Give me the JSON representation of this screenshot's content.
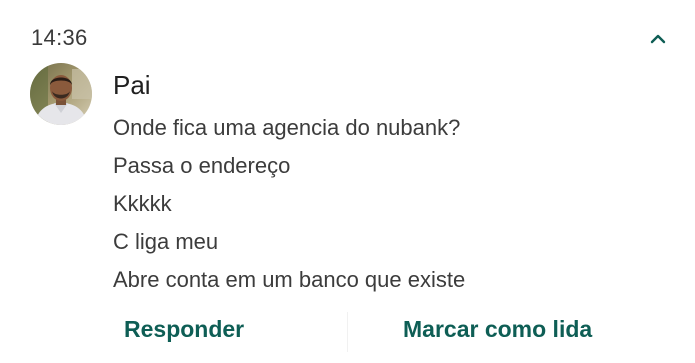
{
  "notification": {
    "time": "14:36",
    "sender": "Pai",
    "messages": [
      "Onde fica uma agencia do nubank?",
      "Passa o endereço",
      "Kkkkk",
      "C liga meu",
      "Abre conta em um banco que existe"
    ],
    "actions": {
      "reply": "Responder",
      "mark_read": "Marcar como lida"
    }
  },
  "icons": {
    "collapse": "chevron-up-icon",
    "avatar": "contact-avatar"
  },
  "colors": {
    "accent": "#0e5e55",
    "text_primary": "#202020",
    "text_secondary": "#3c3c3c",
    "background": "#ffffff"
  }
}
